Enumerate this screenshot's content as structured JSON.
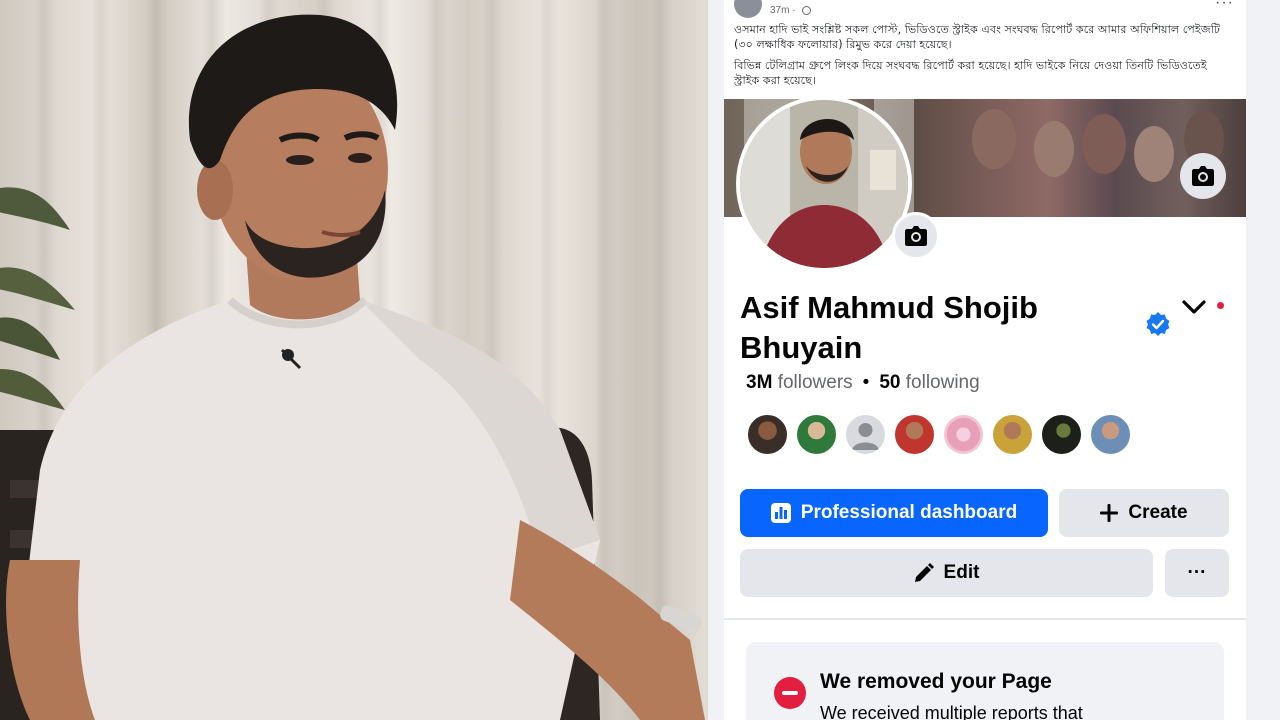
{
  "post": {
    "time": "37m ·",
    "paragraph1": "ওসমান হাদি ভাই সংশ্লিষ্ট সকল পোস্ট, ভিডিওতে স্ট্রাইক এবং সংঘবদ্ধ রিপোর্ট করে আমার অফিশিয়াল পেইজটি (৩০ লক্ষাধিক ফলোয়ার) রিমুভ করে দেয়া হয়েছে।",
    "paragraph2": "বিভিন্ন টেলিগ্রাম গ্রুপে লিংক দিয়ে সংঘবদ্ধ রিপোর্ট করা হয়েছে। হাদি ভাইকে নিয়ে দেওয়া তিনটি ভিডিওতেই স্ট্রাইক করা হয়েছে।"
  },
  "profile": {
    "name": "Asif Mahmud Shojib Bhuyain",
    "followers_count": "3M",
    "followers_label": "followers",
    "separator": "•",
    "following_count": "50",
    "following_label": "following"
  },
  "buttons": {
    "professional_dashboard": "Professional dashboard",
    "create": "Create",
    "edit": "Edit",
    "more": "···"
  },
  "notice": {
    "title": "We removed your Page",
    "body": "We received multiple reports that"
  },
  "colors": {
    "primary_blue": "#0866ff",
    "verified_blue": "#1877f2",
    "alert_red": "#e41e3f",
    "button_gray": "#e4e6eb"
  },
  "friend_avatars": [
    {
      "icon": "friend-avatar",
      "tone": "#3a2e28"
    },
    {
      "icon": "friend-avatar",
      "tone": "#2f7a3a"
    },
    {
      "icon": "default-person-icon",
      "tone": "#c9ccd1"
    },
    {
      "icon": "friend-avatar",
      "tone": "#c0352e"
    },
    {
      "icon": "friend-avatar",
      "tone": "#e8a0b8"
    },
    {
      "icon": "friend-avatar",
      "tone": "#c9a23a"
    },
    {
      "icon": "friend-avatar",
      "tone": "#1c1f1a"
    },
    {
      "icon": "friend-avatar",
      "tone": "#6d8fb6"
    }
  ]
}
